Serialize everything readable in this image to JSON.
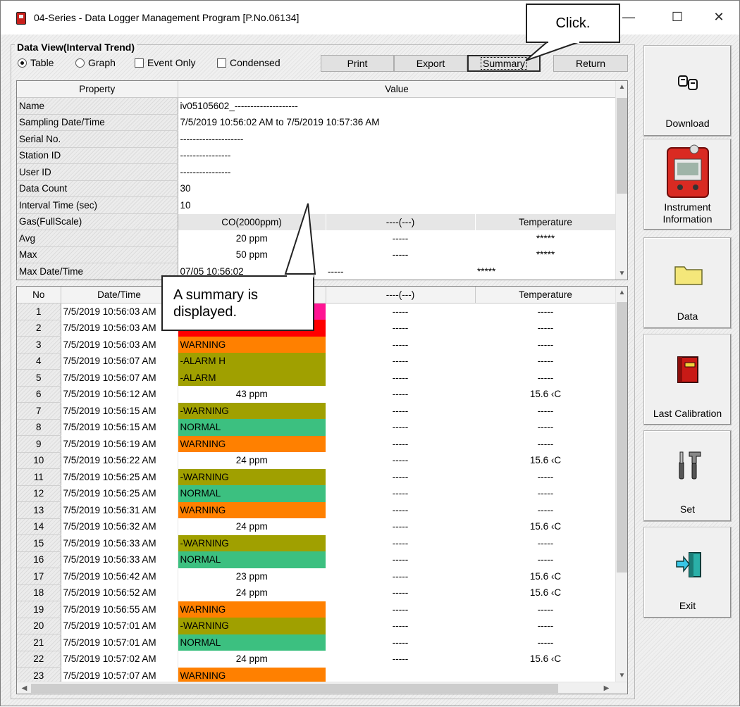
{
  "window": {
    "title": "04-Series - Data Logger Management Program [P.No.06134]",
    "minimize_glyph": "—",
    "maximize_glyph": "☐",
    "close_glyph": "✕"
  },
  "view": {
    "group_label": "Data View(Interval Trend)",
    "table_label": "Table",
    "graph_label": "Graph",
    "event_only_label": "Event Only",
    "condensed_label": "Condensed",
    "table_selected": true,
    "event_only_checked": false,
    "condensed_checked": false
  },
  "toolbar": {
    "print_label": "Print",
    "export_label": "Export",
    "summary_label": "Summary",
    "return_label": "Return"
  },
  "summary": {
    "header_property": "Property",
    "header_value": "Value",
    "rows": [
      {
        "property": "Name",
        "value": "iv05105602_--------------------"
      },
      {
        "property": "Sampling Date/Time",
        "value": "7/5/2019 10:56:02 AM to 7/5/2019 10:57:36 AM"
      },
      {
        "property": "Serial No.",
        "value": "--------------------"
      },
      {
        "property": "Station ID",
        "value": "----------------"
      },
      {
        "property": "User ID",
        "value": "----------------"
      },
      {
        "property": "Data Count",
        "value": "30"
      },
      {
        "property": "Interval Time (sec)",
        "value": "10"
      }
    ],
    "gas_row": {
      "property": "Gas(FullScale)",
      "co": "CO(2000ppm)",
      "gas2": "----(---)",
      "temp": "Temperature"
    },
    "stat_rows": [
      {
        "property": "Avg",
        "co": "20 ppm",
        "gas2": "-----",
        "temp": "*****"
      },
      {
        "property": "Max",
        "co": "50 ppm",
        "gas2": "-----",
        "temp": "*****"
      },
      {
        "property": "Max Date/Time",
        "co": "07/05 10:56:02",
        "gas2": "-----",
        "temp": "*****"
      }
    ]
  },
  "data_table": {
    "headers": {
      "no": "No",
      "datetime": "Date/Time",
      "gas2": "----(---)",
      "temp": "Temperature"
    },
    "rows": [
      {
        "no": "1",
        "datetime": "7/5/2019 10:56:03 AM",
        "co": "",
        "co_color": "#ff1493",
        "gas2": "-----",
        "temp": "-----"
      },
      {
        "no": "2",
        "datetime": "7/5/2019 10:56:03 AM",
        "co": "",
        "co_color": "#ff0000",
        "gas2": "-----",
        "temp": "-----"
      },
      {
        "no": "3",
        "datetime": "7/5/2019 10:56:03 AM",
        "co": "WARNING",
        "co_color": "#ff8000",
        "gas2": "-----",
        "temp": "-----"
      },
      {
        "no": "4",
        "datetime": "7/5/2019 10:56:07 AM",
        "co": "-ALARM H",
        "co_color": "#a0a000",
        "gas2": "-----",
        "temp": "-----"
      },
      {
        "no": "5",
        "datetime": "7/5/2019 10:56:07 AM",
        "co": "-ALARM",
        "co_color": "#a0a000",
        "gas2": "-----",
        "temp": "-----"
      },
      {
        "no": "6",
        "datetime": "7/5/2019 10:56:12 AM",
        "co": "43 ppm",
        "co_color": "",
        "gas2": "-----",
        "temp": "15.6 ‹C"
      },
      {
        "no": "7",
        "datetime": "7/5/2019 10:56:15 AM",
        "co": "-WARNING",
        "co_color": "#a0a000",
        "gas2": "-----",
        "temp": "-----"
      },
      {
        "no": "8",
        "datetime": "7/5/2019 10:56:15 AM",
        "co": "NORMAL",
        "co_color": "#3cc080",
        "gas2": "-----",
        "temp": "-----"
      },
      {
        "no": "9",
        "datetime": "7/5/2019 10:56:19 AM",
        "co": "WARNING",
        "co_color": "#ff8000",
        "gas2": "-----",
        "temp": "-----"
      },
      {
        "no": "10",
        "datetime": "7/5/2019 10:56:22 AM",
        "co": "24 ppm",
        "co_color": "",
        "gas2": "-----",
        "temp": "15.6 ‹C"
      },
      {
        "no": "11",
        "datetime": "7/5/2019 10:56:25 AM",
        "co": "-WARNING",
        "co_color": "#a0a000",
        "gas2": "-----",
        "temp": "-----"
      },
      {
        "no": "12",
        "datetime": "7/5/2019 10:56:25 AM",
        "co": "NORMAL",
        "co_color": "#3cc080",
        "gas2": "-----",
        "temp": "-----"
      },
      {
        "no": "13",
        "datetime": "7/5/2019 10:56:31 AM",
        "co": "WARNING",
        "co_color": "#ff8000",
        "gas2": "-----",
        "temp": "-----"
      },
      {
        "no": "14",
        "datetime": "7/5/2019 10:56:32 AM",
        "co": "24 ppm",
        "co_color": "",
        "gas2": "-----",
        "temp": "15.6 ‹C"
      },
      {
        "no": "15",
        "datetime": "7/5/2019 10:56:33 AM",
        "co": "-WARNING",
        "co_color": "#a0a000",
        "gas2": "-----",
        "temp": "-----"
      },
      {
        "no": "16",
        "datetime": "7/5/2019 10:56:33 AM",
        "co": "NORMAL",
        "co_color": "#3cc080",
        "gas2": "-----",
        "temp": "-----"
      },
      {
        "no": "17",
        "datetime": "7/5/2019 10:56:42 AM",
        "co": "23 ppm",
        "co_color": "",
        "gas2": "-----",
        "temp": "15.6 ‹C"
      },
      {
        "no": "18",
        "datetime": "7/5/2019 10:56:52 AM",
        "co": "24 ppm",
        "co_color": "",
        "gas2": "-----",
        "temp": "15.6 ‹C"
      },
      {
        "no": "19",
        "datetime": "7/5/2019 10:56:55 AM",
        "co": "WARNING",
        "co_color": "#ff8000",
        "gas2": "-----",
        "temp": "-----"
      },
      {
        "no": "20",
        "datetime": "7/5/2019 10:57:01 AM",
        "co": "-WARNING",
        "co_color": "#a0a000",
        "gas2": "-----",
        "temp": "-----"
      },
      {
        "no": "21",
        "datetime": "7/5/2019 10:57:01 AM",
        "co": "NORMAL",
        "co_color": "#3cc080",
        "gas2": "-----",
        "temp": "-----"
      },
      {
        "no": "22",
        "datetime": "7/5/2019 10:57:02 AM",
        "co": "24 ppm",
        "co_color": "",
        "gas2": "-----",
        "temp": "15.6 ‹C"
      },
      {
        "no": "23",
        "datetime": "7/5/2019 10:57:07 AM",
        "co": "WARNING",
        "co_color": "#ff8000",
        "gas2": "",
        "temp": ""
      }
    ]
  },
  "sidebar": {
    "download_label": "Download",
    "instrument_label": "Instrument Information",
    "data_label": "Data",
    "last_calibration_label": "Last Calibration",
    "set_label": "Set",
    "exit_label": "Exit"
  },
  "callouts": {
    "click_text": "Click.",
    "summary_text": "A summary is displayed."
  },
  "icons": {
    "scroll_up": "▲",
    "scroll_down": "▼",
    "scroll_left": "◀",
    "scroll_right": "▶"
  }
}
